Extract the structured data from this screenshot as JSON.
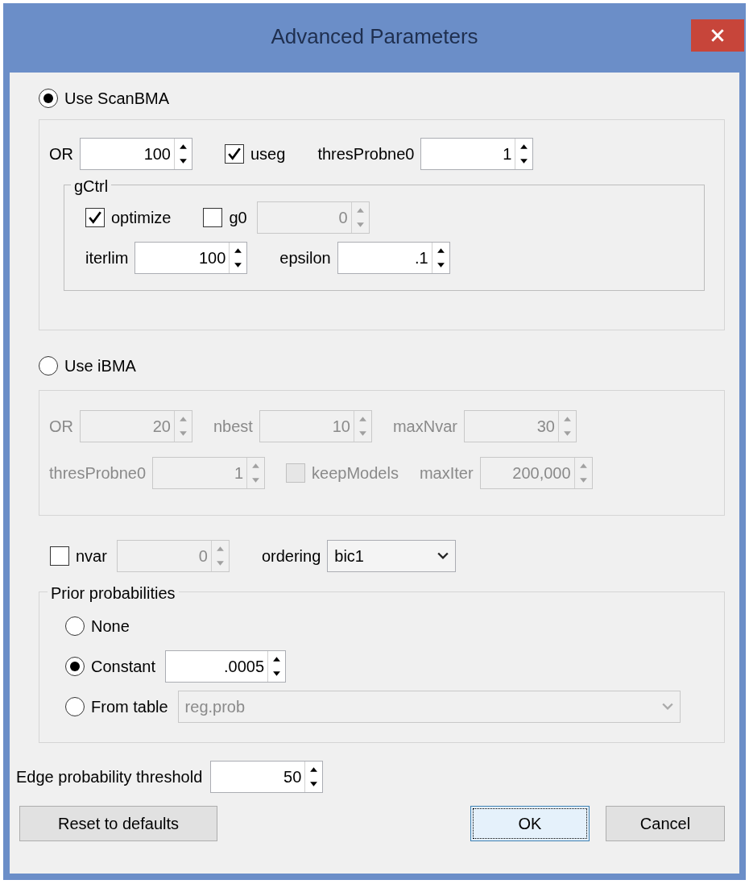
{
  "window": {
    "title": "Advanced Parameters"
  },
  "scan_bma": {
    "label": "Use ScanBMA",
    "selected": true,
    "rows": [
      [
        {
          "kind": "spin",
          "label": "OR",
          "value": "100",
          "disabled": false
        },
        {
          "kind": "check",
          "label": "useg",
          "checked": true,
          "disabled": false
        },
        {
          "kind": "spin",
          "label": "thresProbne0",
          "value": "1",
          "disabled": false
        }
      ]
    ],
    "gctrl": {
      "title": "gCtrl",
      "rows": [
        [
          {
            "kind": "check",
            "label": "optimize",
            "checked": true,
            "disabled": false
          },
          {
            "kind": "checkspin",
            "label": "g0",
            "checked": false,
            "value": "0",
            "disabled": true
          }
        ],
        [
          {
            "kind": "spin",
            "label": "iterlim",
            "value": "100",
            "disabled": false
          },
          {
            "kind": "spin",
            "label": "epsilon",
            "value": ".1",
            "disabled": false
          }
        ]
      ]
    }
  },
  "ibma": {
    "label": "Use iBMA",
    "selected": false,
    "rows": [
      [
        {
          "kind": "spin",
          "label": "OR",
          "value": "20",
          "disabled": true
        },
        {
          "kind": "spin",
          "label": "nbest",
          "value": "10",
          "disabled": true
        },
        {
          "kind": "spin",
          "label": "maxNvar",
          "value": "30",
          "disabled": true
        }
      ],
      [
        {
          "kind": "spin",
          "label": "thresProbne0",
          "value": "1",
          "disabled": true
        },
        {
          "kind": "check",
          "label": "keepModels",
          "checked": false,
          "disabled": true
        },
        {
          "kind": "spin",
          "label": "maxIter",
          "value": "200,000",
          "disabled": true
        }
      ]
    ]
  },
  "options_row": [
    {
      "kind": "checkspin",
      "label": "nvar",
      "checked": false,
      "value": "0",
      "disabled": true
    },
    {
      "kind": "select",
      "label": "ordering",
      "value": "bic1",
      "disabled": false
    }
  ],
  "prior": {
    "title": "Prior probabilities",
    "options": [
      {
        "kind": "plain",
        "label": "None",
        "selected": false
      },
      {
        "kind": "spin",
        "label": "Constant",
        "selected": true,
        "value": ".0005",
        "disabled": false
      },
      {
        "kind": "select",
        "label": "From table",
        "selected": false,
        "value": "reg.prob",
        "disabled": true
      }
    ]
  },
  "edge": {
    "label": "Edge probability threshold",
    "value": "50",
    "disabled": false
  },
  "buttons": [
    {
      "label": "Reset to defaults",
      "focused": false
    },
    {
      "label": "OK",
      "focused": true
    },
    {
      "label": "Cancel",
      "focused": false
    }
  ]
}
